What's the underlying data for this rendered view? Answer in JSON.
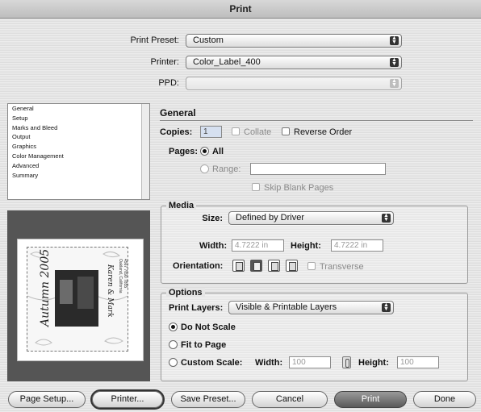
{
  "window": {
    "title": "Print"
  },
  "top": {
    "preset_label": "Print Preset:",
    "preset_value": "Custom",
    "printer_label": "Printer:",
    "printer_value": "Color_Label_400",
    "ppd_label": "PPD:",
    "ppd_value": ""
  },
  "sidebar": {
    "items": [
      {
        "label": "General"
      },
      {
        "label": "Setup"
      },
      {
        "label": "Marks and Bleed"
      },
      {
        "label": "Output"
      },
      {
        "label": "Graphics"
      },
      {
        "label": "Color Management"
      },
      {
        "label": "Advanced"
      },
      {
        "label": "Summary"
      }
    ]
  },
  "preview": {
    "art_text_1": "Autumn 2005",
    "art_text_2": "Karen & Mark",
    "art_text_3": "Oakland, California",
    "art_text_4": "4567 7890 7855"
  },
  "general": {
    "title": "General",
    "copies_label": "Copies:",
    "copies_value": "1",
    "collate_label": "Collate",
    "reverse_label": "Reverse Order",
    "pages_label": "Pages:",
    "all_label": "All",
    "range_label": "Range:",
    "range_value": "",
    "skip_label": "Skip Blank Pages"
  },
  "media": {
    "title": "Media",
    "size_label": "Size:",
    "size_value": "Defined by Driver",
    "width_label": "Width:",
    "width_value": "4.7222 in",
    "height_label": "Height:",
    "height_value": "4.7222 in",
    "orientation_label": "Orientation:",
    "transverse_label": "Transverse"
  },
  "options": {
    "title": "Options",
    "layers_label": "Print Layers:",
    "layers_value": "Visible & Printable Layers",
    "no_scale_label": "Do Not Scale",
    "fit_label": "Fit to Page",
    "custom_label": "Custom Scale:",
    "width_label": "Width:",
    "width_value": "100",
    "height_label": "Height:",
    "height_value": "100"
  },
  "buttons": {
    "page_setup": "Page Setup...",
    "printer": "Printer...",
    "save_preset": "Save Preset...",
    "cancel": "Cancel",
    "print": "Print",
    "done": "Done"
  }
}
